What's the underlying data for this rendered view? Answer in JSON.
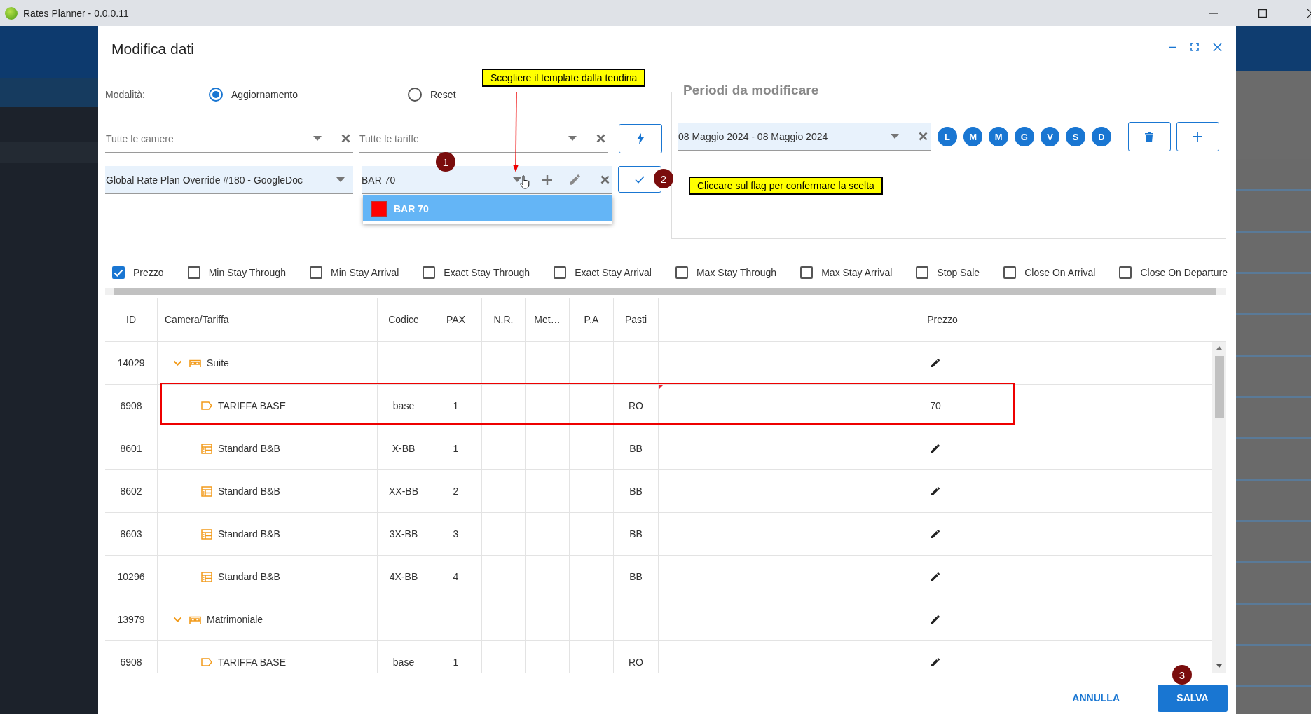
{
  "window": {
    "title": "Rates Planner - 0.0.0.11"
  },
  "dialog": {
    "title": "Modifica dati"
  },
  "mode": {
    "label": "Modalità:",
    "options": [
      {
        "label": "Aggiornamento",
        "selected": true
      },
      {
        "label": "Reset",
        "selected": false
      }
    ]
  },
  "filters": [
    {
      "placeholder": "Tutte le camere"
    },
    {
      "placeholder": "Tutte le tariffe"
    }
  ],
  "rate_plan": {
    "value": "Global Rate Plan Override #180 - GoogleDoc"
  },
  "template": {
    "value": "BAR 70",
    "options": [
      {
        "label": "BAR 70",
        "color": "#ff0000",
        "selected": true
      }
    ]
  },
  "periods": {
    "title": "Periodi da modificare",
    "range": "08 Maggio 2024 - 08 Maggio 2024",
    "days": [
      {
        "label": "L",
        "selected": true
      },
      {
        "label": "M",
        "selected": true
      },
      {
        "label": "M",
        "selected": true
      },
      {
        "label": "G",
        "selected": true
      },
      {
        "label": "V",
        "selected": true
      },
      {
        "label": "S",
        "selected": true
      },
      {
        "label": "D",
        "selected": true
      }
    ]
  },
  "fields": [
    {
      "label": "Prezzo",
      "checked": true
    },
    {
      "label": "Min Stay Through",
      "checked": false
    },
    {
      "label": "Min Stay Arrival",
      "checked": false
    },
    {
      "label": "Exact Stay Through",
      "checked": false
    },
    {
      "label": "Exact Stay Arrival",
      "checked": false
    },
    {
      "label": "Max Stay Through",
      "checked": false
    },
    {
      "label": "Max Stay Arrival",
      "checked": false
    },
    {
      "label": "Stop Sale",
      "checked": false
    },
    {
      "label": "Close On Arrival",
      "checked": false
    },
    {
      "label": "Close On Departure",
      "checked": false
    }
  ],
  "table": {
    "columns": [
      "ID",
      "Camera/Tariffa",
      "Codice",
      "PAX",
      "N.R.",
      "Met…",
      "P.A",
      "Pasti",
      "Prezzo"
    ],
    "rows": [
      {
        "id": "14029",
        "name": "Suite",
        "kind": "room",
        "expanded": true,
        "children": [
          {
            "id": "6908",
            "name": "TARIFFA BASE",
            "kind": "rate",
            "code": "base",
            "pax": "1",
            "meals": "RO",
            "price": "70",
            "modified": true
          },
          {
            "id": "8601",
            "name": "Standard B&B",
            "kind": "package",
            "code": "X-BB",
            "pax": "1",
            "meals": "BB",
            "modified": false
          },
          {
            "id": "8602",
            "name": "Standard B&B",
            "kind": "package",
            "code": "XX-BB",
            "pax": "2",
            "meals": "BB",
            "modified": false
          },
          {
            "id": "8603",
            "name": "Standard B&B",
            "kind": "package",
            "code": "3X-BB",
            "pax": "3",
            "meals": "BB",
            "modified": false
          },
          {
            "id": "10296",
            "name": "Standard B&B",
            "kind": "package",
            "code": "4X-BB",
            "pax": "4",
            "meals": "BB",
            "modified": false
          }
        ]
      },
      {
        "id": "13979",
        "name": "Matrimoniale",
        "kind": "room",
        "expanded": true,
        "children": [
          {
            "id": "6908",
            "name": "TARIFFA BASE",
            "kind": "rate",
            "code": "base",
            "pax": "1",
            "meals": "RO",
            "modified": false
          }
        ]
      }
    ]
  },
  "annotations": {
    "callouts": [
      "Scegliere il template dalla tendina",
      "Cliccare sul flag per confermare la scelta"
    ],
    "steps": [
      "1",
      "2",
      "3"
    ]
  },
  "actions": [
    {
      "label": "ANNULLA",
      "kind": "text"
    },
    {
      "label": "SALVA",
      "kind": "primary"
    }
  ]
}
